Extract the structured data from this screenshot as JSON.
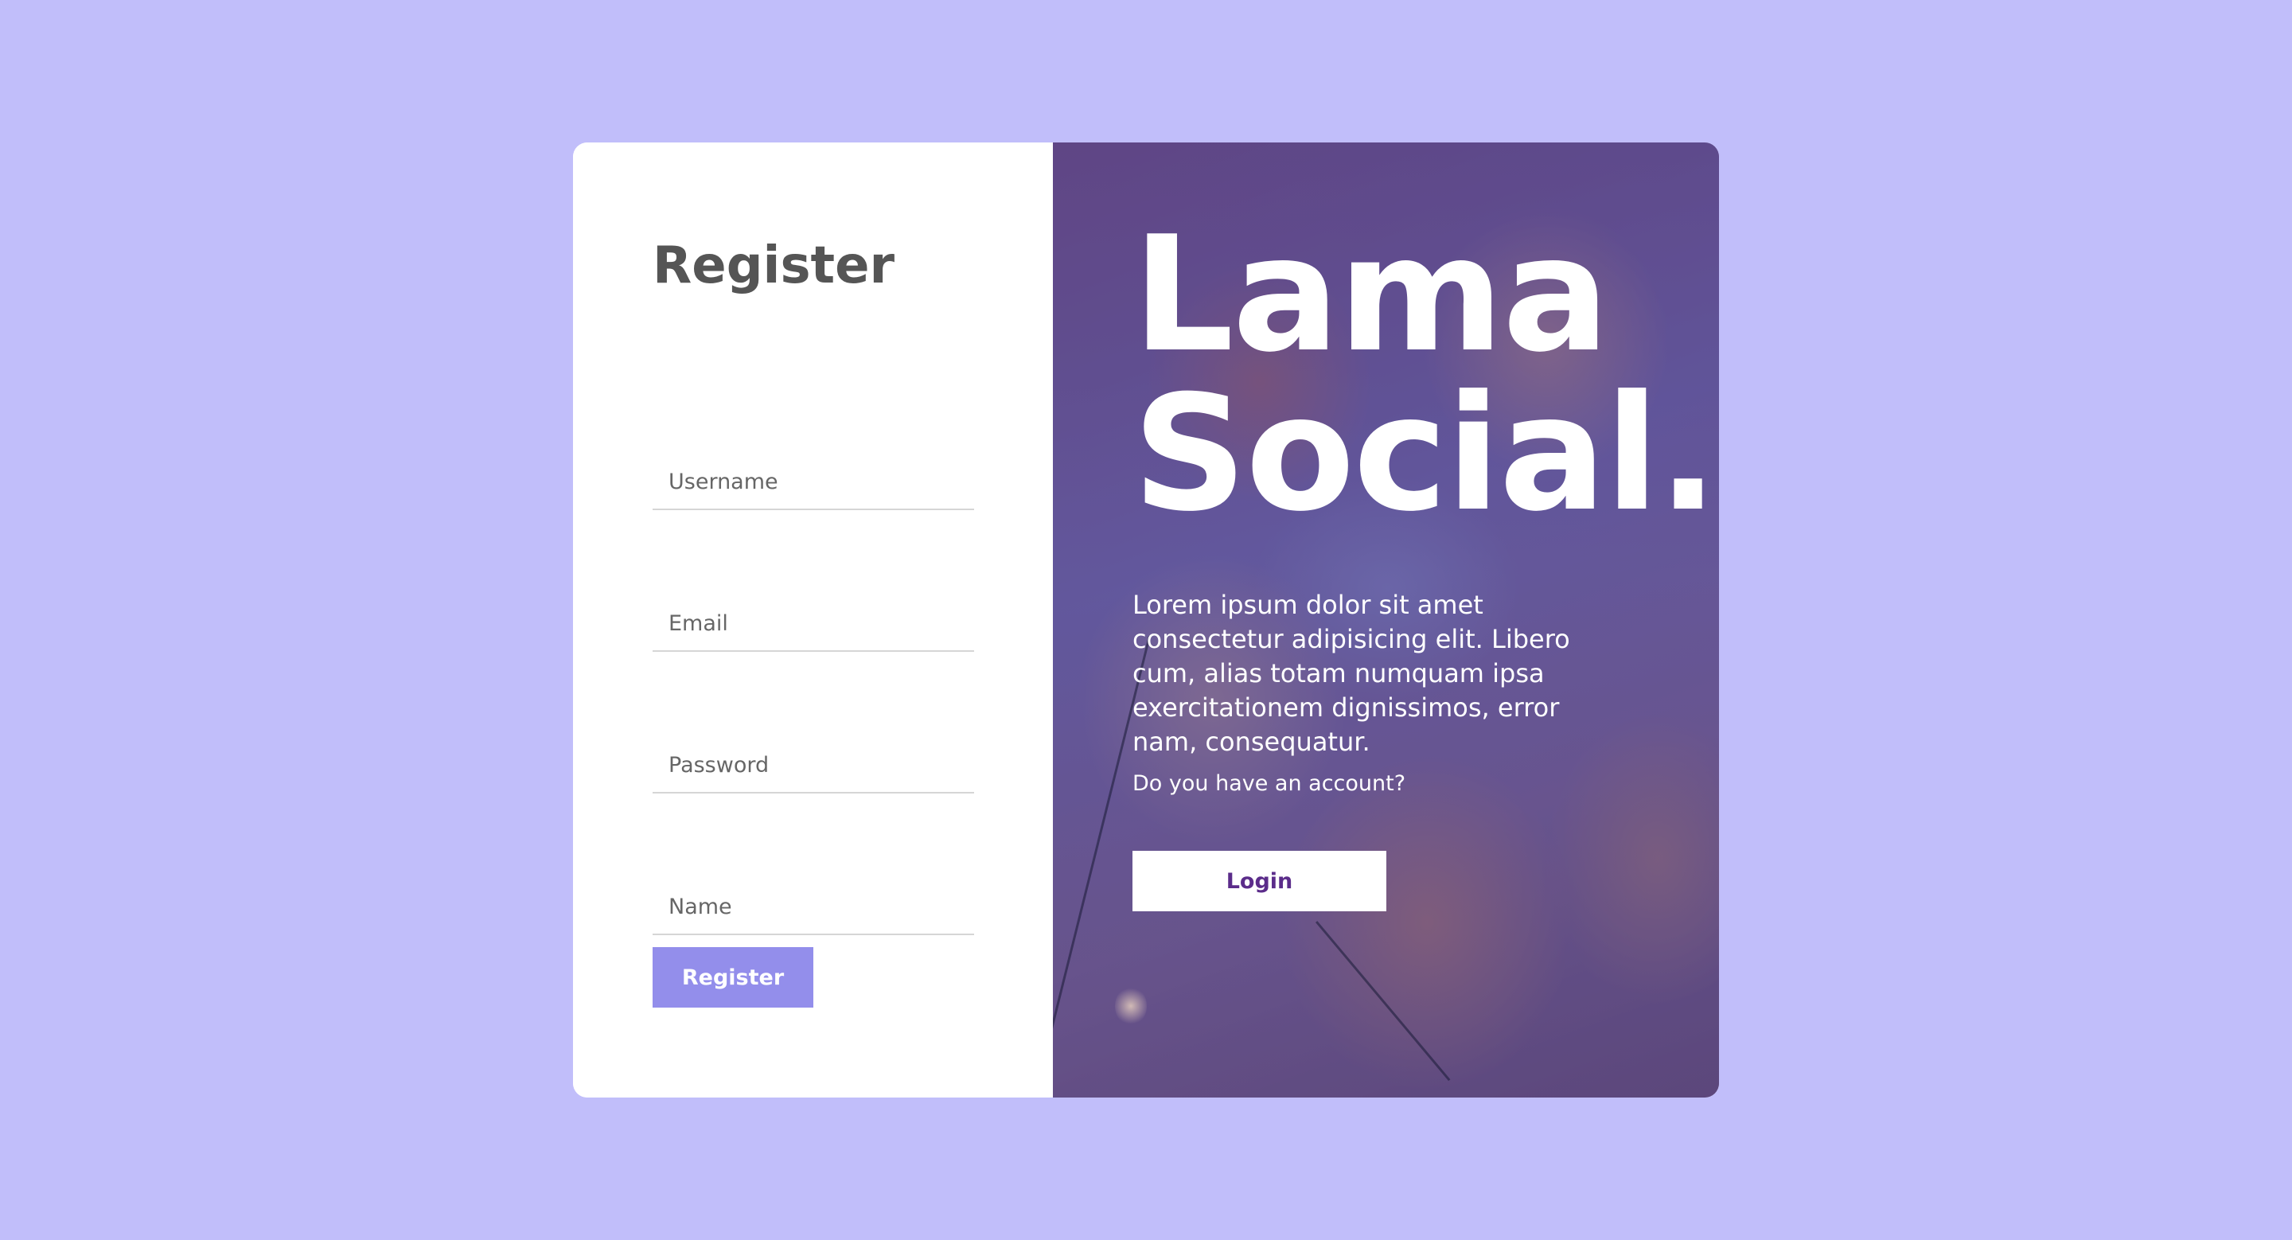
{
  "register_panel": {
    "title": "Register",
    "fields": [
      {
        "placeholder": "Username"
      },
      {
        "placeholder": "Email"
      },
      {
        "placeholder": "Password"
      },
      {
        "placeholder": "Name"
      }
    ],
    "submit_label": "Register"
  },
  "brand_panel": {
    "brand_line1": "Lama",
    "brand_line2": "Social.",
    "description": "Lorem ipsum dolor sit amet consectetur adipisicing elit. Libero cum, alias totam numquam ipsa exercitationem dignissimos, error nam, consequatur.",
    "account_question": "Do you have an account?",
    "login_label": "Login"
  },
  "colors": {
    "page_background": "#c1befa",
    "register_button": "#938eeb",
    "login_text": "#5b2c8a",
    "title_text": "#555555"
  }
}
